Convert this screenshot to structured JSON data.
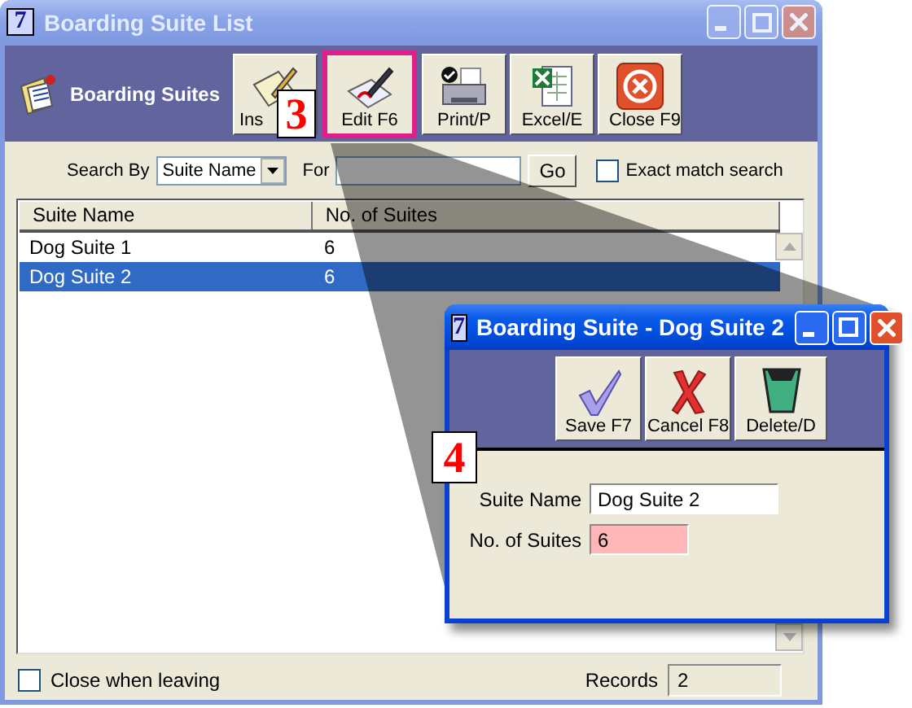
{
  "main_window": {
    "app_icon": "7",
    "title": "Boarding Suite List",
    "active": false,
    "header_label": "Boarding Suites",
    "toolbar": [
      {
        "label": "Ins",
        "highlighted": false
      },
      {
        "label": "Edit F6",
        "highlighted": true
      },
      {
        "label": "Print/P",
        "highlighted": false
      },
      {
        "label": "Excel/E",
        "highlighted": false
      },
      {
        "label": "Close F9",
        "highlighted": false
      }
    ],
    "search": {
      "label": "Search By",
      "field": "Suite Name",
      "for_label": "For",
      "go": "Go",
      "exact_match": {
        "label": "Exact match search",
        "checked": false
      }
    },
    "table": {
      "columns": [
        "Suite Name",
        "No. of Suites"
      ],
      "rows": [
        {
          "cells": [
            "Dog Suite 1",
            "6"
          ],
          "selected": false
        },
        {
          "cells": [
            "Dog Suite 2",
            "6"
          ],
          "selected": true
        }
      ]
    },
    "close_when_leaving": {
      "label": "Close when leaving",
      "checked": false
    },
    "records": {
      "label": "Records",
      "value": "2"
    }
  },
  "dialog": {
    "app_icon": "7",
    "title": "Boarding Suite - Dog Suite 2",
    "active": true,
    "toolbar": [
      {
        "label": "Save F7"
      },
      {
        "label": "Cancel F8"
      },
      {
        "label": "Delete/D"
      }
    ],
    "fields": [
      {
        "label": "Suite Name",
        "value": "Dog Suite 2",
        "required": false
      },
      {
        "label": "No. of Suites",
        "value": "6",
        "required": true
      }
    ]
  },
  "callouts": [
    {
      "number": "3"
    },
    {
      "number": "4"
    }
  ]
}
